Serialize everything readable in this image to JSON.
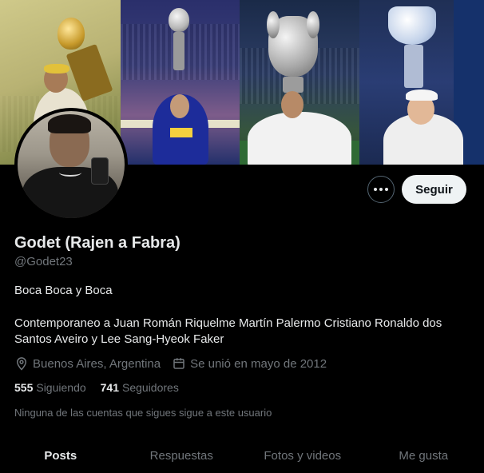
{
  "profile": {
    "name": "Godet (Rajen a Fabra)",
    "handle": "@Godet23",
    "bio_line1": "Boca Boca y Boca",
    "bio_line2": "Contemporaneo a Juan Román Riquelme Martín Palermo Cristiano Ronaldo dos Santos Aveiro y Lee Sang-Hyeok Faker",
    "location": "Buenos Aires, Argentina",
    "joined": "Se unió en mayo de 2012",
    "following_count": "555",
    "following_label": "Siguiendo",
    "followers_count": "741",
    "followers_label": "Seguidores",
    "mutuals_note": "Ninguna de las cuentas que sigues sigue a este usuario"
  },
  "actions": {
    "follow_label": "Seguir",
    "more_icon": "more-horizontal-icon"
  },
  "tabs": [
    {
      "label": "Posts",
      "active": true
    },
    {
      "label": "Respuestas",
      "active": false
    },
    {
      "label": "Fotos y videos",
      "active": false
    },
    {
      "label": "Me gusta",
      "active": false
    }
  ],
  "colors": {
    "background": "#000000",
    "text_primary": "#e7e9ea",
    "text_secondary": "#71767b",
    "follow_button_bg": "#eff3f4"
  }
}
